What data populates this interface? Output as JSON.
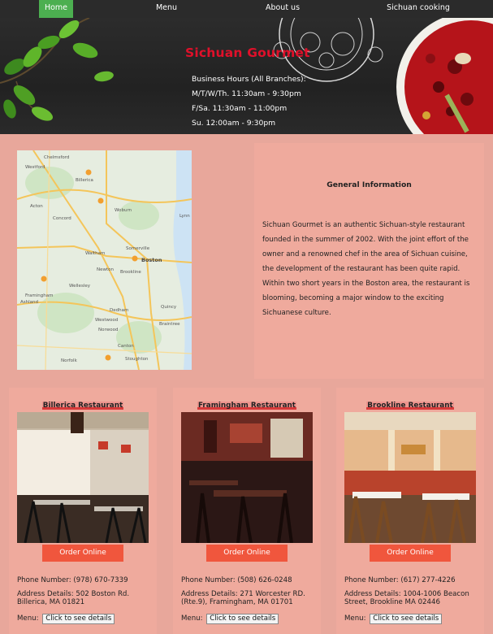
{
  "nav": {
    "items": [
      {
        "label": "Home",
        "active": true
      },
      {
        "label": "Menu",
        "active": false
      },
      {
        "label": "About us",
        "active": false
      },
      {
        "label": "Sichuan cooking",
        "active": false
      }
    ]
  },
  "hero": {
    "title": "Sichuan Gourmet",
    "hours_label": "Business Hours (All Branches):",
    "hours": [
      "M/T/W/Th. 11:30am - 9:30pm",
      "F/Sa. 11:30am - 11:00pm",
      "Su. 12:00am - 9:30pm"
    ]
  },
  "map": {
    "places": [
      "Chelmsford",
      "Westford",
      "Billerica",
      "Concord",
      "Woburn",
      "Lynn",
      "Acton",
      "Somerville",
      "Waltham",
      "Newton",
      "Boston",
      "Brookline",
      "Wellesley",
      "Framingham",
      "Ashland",
      "Dedham",
      "Quincy",
      "Westwood",
      "Norwood",
      "Braintree",
      "Canton",
      "Stoughton",
      "Norfolk"
    ]
  },
  "info": {
    "title": "General Information",
    "body": "Sichuan Gourmet is an authentic Sichuan-style restaurant founded in the summer of 2002. With the joint effort of the owner and a renowned chef in the area of Sichuan cuisine, the development of the restaurant has been quite rapid. Within two short years in the Boston area, the restaurant is blooming, becoming a major window to the exciting Sichuanese culture."
  },
  "restaurants": [
    {
      "name": "Billerica Restaurant",
      "order_label": "Order Online",
      "phone": "Phone Number: (978) 670-7339",
      "address": "Address Details: 502 Boston Rd. Billerica, MA 01821",
      "menu_label": "Menu:",
      "details_label": "Click to see details"
    },
    {
      "name": "Framingham Restaurant",
      "order_label": "Order Online",
      "phone": "Phone Number: (508) 626-0248",
      "address": "Address Details: 271 Worcester RD. (Rte.9), Framingham, MA 01701",
      "menu_label": "Menu:",
      "details_label": "Click to see details"
    },
    {
      "name": "Brookline Restaurant",
      "order_label": "Order Online",
      "phone": "Phone Number: (617) 277-4226",
      "address": "Address Details: 1004-1006 Beacon Street, Brookline MA 02446",
      "menu_label": "Menu:",
      "details_label": "Click to see details"
    }
  ],
  "colors": {
    "page_bg": "#e8a79b",
    "panel_bg": "#efaa9d",
    "nav_bg": "#2b2b2b",
    "nav_active": "#4caf50",
    "title_red": "#e0102a",
    "order_button": "#f0563d"
  }
}
